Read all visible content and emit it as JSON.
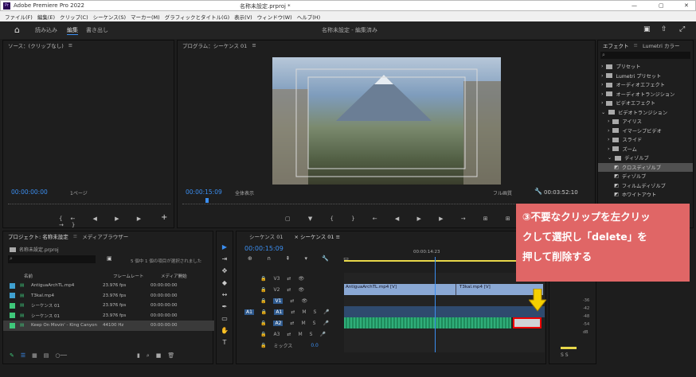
{
  "titlebar": {
    "title": "Adobe Premiere Pro 2022",
    "file": "名称未設定.prproj *",
    "window_controls": [
      "—",
      "▢",
      "✕"
    ]
  },
  "menubar": {
    "items": [
      "ファイル(F)",
      "編集(E)",
      "クリップ(C)",
      "シーケンス(S)",
      "マーカー(M)",
      "グラフィックとタイトル(G)",
      "表示(V)",
      "ウィンドウ(W)",
      "ヘルプ(H)"
    ]
  },
  "workspace": {
    "tabs": [
      "読み込み",
      "編集",
      "書き出し"
    ],
    "active": "編集",
    "center": "名称未設定 - 編集済み"
  },
  "source": {
    "title": "ソース：(クリップなし)",
    "menu": "≡",
    "timecode": "00:00:00:00",
    "zoom": "1ページ"
  },
  "program": {
    "title": "プログラム：シーケンス 01",
    "menu": "≡",
    "timecode": "00:00:15:09",
    "fit": "全体表示",
    "quality": "フル画質",
    "duration": "00:03:52:10"
  },
  "effects": {
    "tabs": [
      "エフェクト",
      "Lumetri カラー"
    ],
    "items": [
      {
        "label": "プリセット",
        "depth": 0
      },
      {
        "label": "Lumetri プリセット",
        "depth": 0
      },
      {
        "label": "オーディオエフェクト",
        "depth": 0
      },
      {
        "label": "オーディオトランジション",
        "depth": 0
      },
      {
        "label": "ビデオエフェクト",
        "depth": 0
      },
      {
        "label": "ビデオトランジション",
        "depth": 0,
        "open": true
      },
      {
        "label": "アイリス",
        "depth": 1
      },
      {
        "label": "イマーシブビデオ",
        "depth": 1
      },
      {
        "label": "スライド",
        "depth": 1
      },
      {
        "label": "ズーム",
        "depth": 1
      },
      {
        "label": "ディゾルブ",
        "depth": 1,
        "open": true
      },
      {
        "label": "クロスディゾルブ",
        "depth": 2,
        "selected": true
      },
      {
        "label": "ディゾルブ",
        "depth": 2
      },
      {
        "label": "フィルムディゾルブ",
        "depth": 2
      },
      {
        "label": "ホワイトアウト",
        "depth": 2
      }
    ]
  },
  "project": {
    "tabs": [
      "プロジェクト: 名称未設定",
      "メディアブラウザー"
    ],
    "file": "名称未設定.prproj",
    "selection": "5 個中 1 個の項目が選択されました",
    "columns": [
      "名前",
      "フレームレート",
      "メディア開始"
    ],
    "rows": [
      {
        "color": "#3fa0d0",
        "name": "AntiguaArchTL.mp4",
        "fps": "23.976 fps",
        "start": "00:00:00:00"
      },
      {
        "color": "#3fa0d0",
        "name": "T3kal.mp4",
        "fps": "23.976 fps",
        "start": "00:00:00:00"
      },
      {
        "color": "#3fc77a",
        "name": "シーケンス 01",
        "fps": "23.976 fps",
        "start": "00:00:00:00"
      },
      {
        "color": "#3fc77a",
        "name": "シーケンス 01",
        "fps": "23.976 fps",
        "start": "00:00:00:00"
      },
      {
        "color": "#3fc77a",
        "name": "Keep On Movin' - King Canyon",
        "fps": "44100 Hz",
        "start": "00:00:00:00"
      }
    ]
  },
  "timeline": {
    "tabs": [
      "シーケンス 01",
      "シーケンス 01"
    ],
    "timecode": "00:00:15:09",
    "ruler": "00:00:14:23",
    "tracks": [
      "V3",
      "V2",
      "V1",
      "A1",
      "A2",
      "A3"
    ],
    "mix_label": "ミックス",
    "mix_value": "0.0",
    "clips": {
      "v2a": "AntiguaArchTL.mp4 [V]",
      "v2b": "T3kal.mp4 [V]"
    }
  },
  "annotation": {
    "lines": [
      "③不要なクリップを左クリッ",
      "クして選択し「delete」を",
      "押して削除する"
    ]
  },
  "meter": {
    "labels": [
      "-36",
      "-42",
      "-48",
      "-54",
      "dB"
    ],
    "solo": "S S"
  }
}
